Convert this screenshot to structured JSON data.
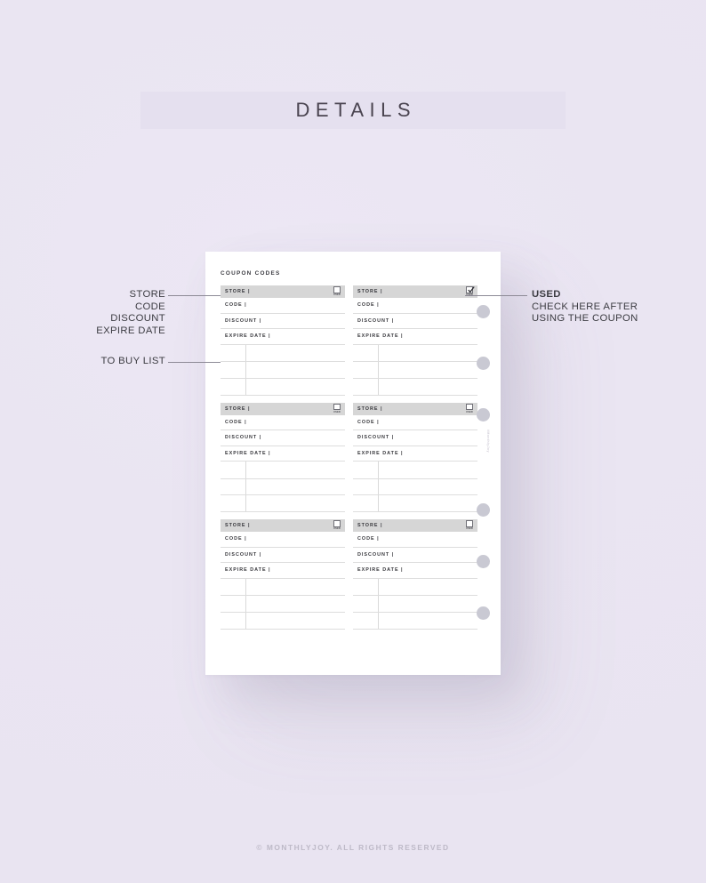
{
  "header": {
    "title": "DETAILS",
    "banner_color": "#e5e0ef"
  },
  "page": {
    "title": "COUPON CODES",
    "watermark": "#MonthlyJoy",
    "background_color": "#ffffff",
    "header_row_color": "#d6d6d6",
    "ring_hole_color": "#c9c9d3",
    "ring_hole_count": 6
  },
  "field_labels": {
    "store": "STORE |",
    "code": "CODE |",
    "discount": "DISCOUNT |",
    "expire_date": "EXPIRE DATE |",
    "used_caption": "USED"
  },
  "coupon_blocks": [
    {
      "cards": [
        {
          "store": "STORE |",
          "code": "CODE |",
          "discount": "DISCOUNT |",
          "expire_date": "EXPIRE DATE |",
          "used_caption": "USED",
          "checked": false
        },
        {
          "store": "STORE |",
          "code": "CODE |",
          "discount": "DISCOUNT |",
          "expire_date": "EXPIRE DATE |",
          "used_caption": "USED",
          "checked": true
        }
      ]
    },
    {
      "cards": [
        {
          "store": "STORE |",
          "code": "CODE |",
          "discount": "DISCOUNT |",
          "expire_date": "EXPIRE DATE |",
          "used_caption": "USED",
          "checked": false
        },
        {
          "store": "STORE |",
          "code": "CODE |",
          "discount": "DISCOUNT |",
          "expire_date": "EXPIRE DATE |",
          "used_caption": "USED",
          "checked": false
        }
      ]
    },
    {
      "cards": [
        {
          "store": "STORE |",
          "code": "CODE |",
          "discount": "DISCOUNT |",
          "expire_date": "EXPIRE DATE |",
          "used_caption": "USED",
          "checked": false
        },
        {
          "store": "STORE |",
          "code": "CODE |",
          "discount": "DISCOUNT |",
          "expire_date": "EXPIRE DATE |",
          "used_caption": "USED",
          "checked": false
        }
      ]
    }
  ],
  "annotations": {
    "left_fields": {
      "line1": "STORE",
      "line2": "CODE",
      "line3": "DISCOUNT",
      "line4": "EXPIRE DATE"
    },
    "left_buy_list": "TO BUY LIST",
    "right_used": {
      "title": "USED",
      "line1": "CHECK HERE AFTER",
      "line2": "USING THE COUPON"
    }
  },
  "footer": {
    "text": "© MONTHLYJOY. ALL RIGHTS RESERVED"
  }
}
